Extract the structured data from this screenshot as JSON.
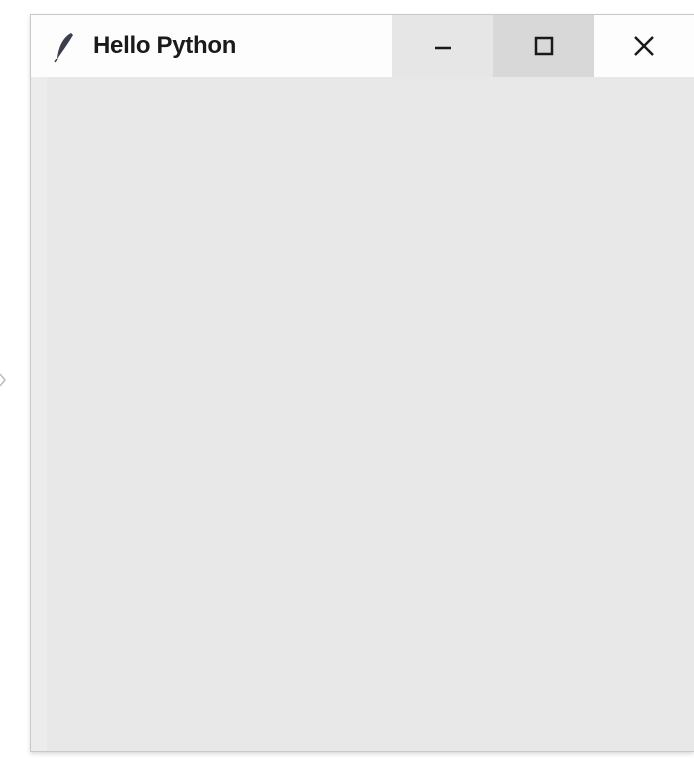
{
  "window": {
    "title": "Hello Python",
    "app_icon": "feather-icon",
    "controls": {
      "minimize_icon": "minimize-icon",
      "maximize_icon": "maximize-icon",
      "close_icon": "close-icon"
    }
  },
  "colors": {
    "titlebar_bg": "#fdfdfd",
    "client_bg": "#e8e8e8",
    "minimize_bg": "#e6e6e6",
    "maximize_bg": "#d8d8d8",
    "icon_color": "#1a1a1a"
  }
}
